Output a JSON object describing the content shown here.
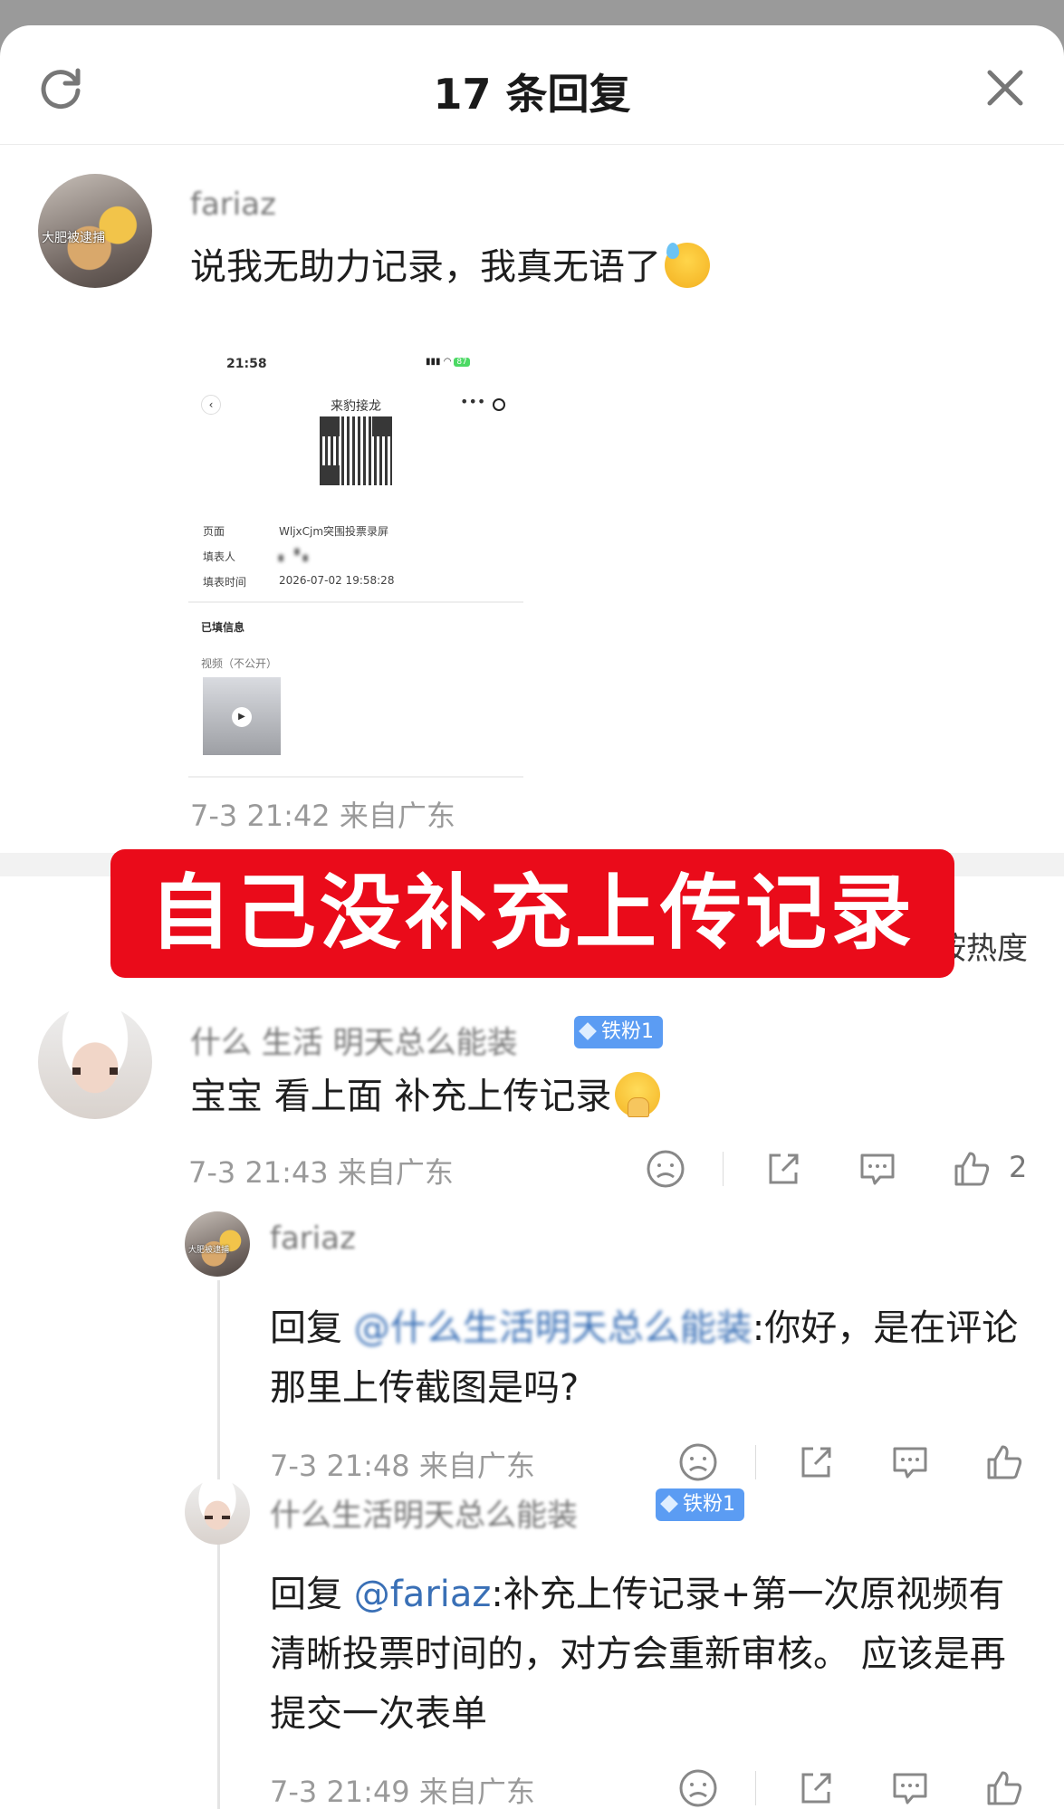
{
  "header": {
    "title": "17 条回复"
  },
  "comment": {
    "username": "fariaz",
    "avatar_tag": "大肥被逮捕",
    "text": "说我无助力记录，我真无语了",
    "meta": "7-3 21:42 来自广东",
    "attachment": {
      "status_time": "21:58",
      "battery": "87",
      "page_title": "来豹接龙",
      "rows": [
        {
          "label": "页面",
          "value": "WljxCjm突围投票录屏"
        },
        {
          "label": "填表人",
          "value": "▖ ▝▗"
        },
        {
          "label": "填表时间",
          "value": "2026-07-02 19:58:28"
        }
      ],
      "section_title": "已填信息",
      "section_sub": "视频（不公开）"
    }
  },
  "overlay_banner": "自己没补充上传记录",
  "sort_label": "按热度",
  "reply1": {
    "username": "什么 生活 明天总么能装",
    "badge": "铁粉1",
    "text": "宝宝 看上面 补充上传记录",
    "meta": "7-3 21:43 来自广东",
    "likes": "2"
  },
  "reply2": {
    "username": "fariaz",
    "avatar_tag": "大肥被逮捕",
    "prefix": "回复 ",
    "mention": "@什么生活明天总么能装",
    "text_after": ":你好，是在评论那里上传截图是吗?",
    "meta": "7-3 21:48 来自广东"
  },
  "reply3": {
    "username": "什么生活明天总么能装",
    "badge": "铁粉1",
    "prefix": "回复 ",
    "mention": "@fariaz",
    "text_after": ":补充上传记录+第一次原视频有清晰投票时间的，对方会重新审核。 应该是再提交一次表单",
    "meta": "7-3 21:49 来自广东"
  },
  "icons": {
    "refresh": "refresh-icon",
    "close": "close-icon",
    "dislike": "sad-face-icon",
    "share": "share-icon",
    "comment": "comment-icon",
    "like": "thumbs-up-icon"
  }
}
